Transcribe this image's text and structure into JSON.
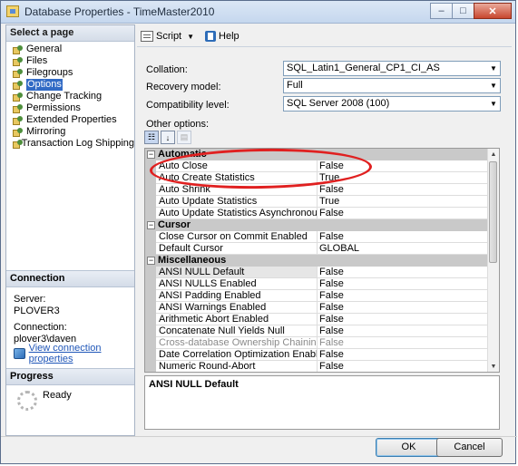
{
  "window": {
    "title": "Database Properties - TimeMaster2010",
    "controls": {
      "minimize": "–",
      "maximize": "□",
      "close": "✕"
    }
  },
  "left_panel": {
    "select_page_header": "Select a page",
    "pages": [
      {
        "label": "General"
      },
      {
        "label": "Files"
      },
      {
        "label": "Filegroups"
      },
      {
        "label": "Options",
        "selected": true
      },
      {
        "label": "Change Tracking"
      },
      {
        "label": "Permissions"
      },
      {
        "label": "Extended Properties"
      },
      {
        "label": "Mirroring"
      },
      {
        "label": "Transaction Log Shipping"
      }
    ],
    "connection": {
      "header": "Connection",
      "server_label": "Server:",
      "server_value": "PLOVER3",
      "connection_label": "Connection:",
      "connection_value": "plover3\\daven",
      "view_link": "View connection properties"
    },
    "progress": {
      "header": "Progress",
      "status": "Ready"
    }
  },
  "toolbar": {
    "script_label": "Script",
    "help_label": "Help"
  },
  "fields": {
    "collation": {
      "label": "Collation:",
      "value": "SQL_Latin1_General_CP1_CI_AS"
    },
    "recovery_model": {
      "label": "Recovery model:",
      "value": "Full"
    },
    "compatibility_level": {
      "label": "Compatibility level:",
      "value": "SQL Server 2008 (100)"
    }
  },
  "other_options_label": "Other options:",
  "grid": {
    "categories": [
      {
        "name": "Automatic",
        "toggle": "−",
        "properties": [
          {
            "name": "Auto Close",
            "value": "False"
          },
          {
            "name": "Auto Create Statistics",
            "value": "True"
          },
          {
            "name": "Auto Shrink",
            "value": "False"
          },
          {
            "name": "Auto Update Statistics",
            "value": "True"
          },
          {
            "name": "Auto Update Statistics Asynchronously",
            "value": "False"
          }
        ]
      },
      {
        "name": "Cursor",
        "toggle": "−",
        "properties": [
          {
            "name": "Close Cursor on Commit Enabled",
            "value": "False"
          },
          {
            "name": "Default Cursor",
            "value": "GLOBAL"
          }
        ]
      },
      {
        "name": "Miscellaneous",
        "toggle": "−",
        "properties": [
          {
            "name": "ANSI NULL Default",
            "value": "False",
            "selected": true
          },
          {
            "name": "ANSI NULLS Enabled",
            "value": "False"
          },
          {
            "name": "ANSI Padding Enabled",
            "value": "False"
          },
          {
            "name": "ANSI Warnings Enabled",
            "value": "False"
          },
          {
            "name": "Arithmetic Abort Enabled",
            "value": "False"
          },
          {
            "name": "Concatenate Null Yields Null",
            "value": "False"
          },
          {
            "name": "Cross-database Ownership Chaining Enabled",
            "value": "False",
            "disabled": true
          },
          {
            "name": "Date Correlation Optimization Enabled",
            "value": "False"
          },
          {
            "name": "Numeric Round-Abort",
            "value": "False"
          }
        ]
      }
    ]
  },
  "description": {
    "title": "ANSI NULL Default"
  },
  "buttons": {
    "ok": "OK",
    "cancel": "Cancel"
  },
  "colors": {
    "selection": "#316ac5",
    "annotation": "#e02020",
    "category_bg": "#c9c9c9"
  }
}
